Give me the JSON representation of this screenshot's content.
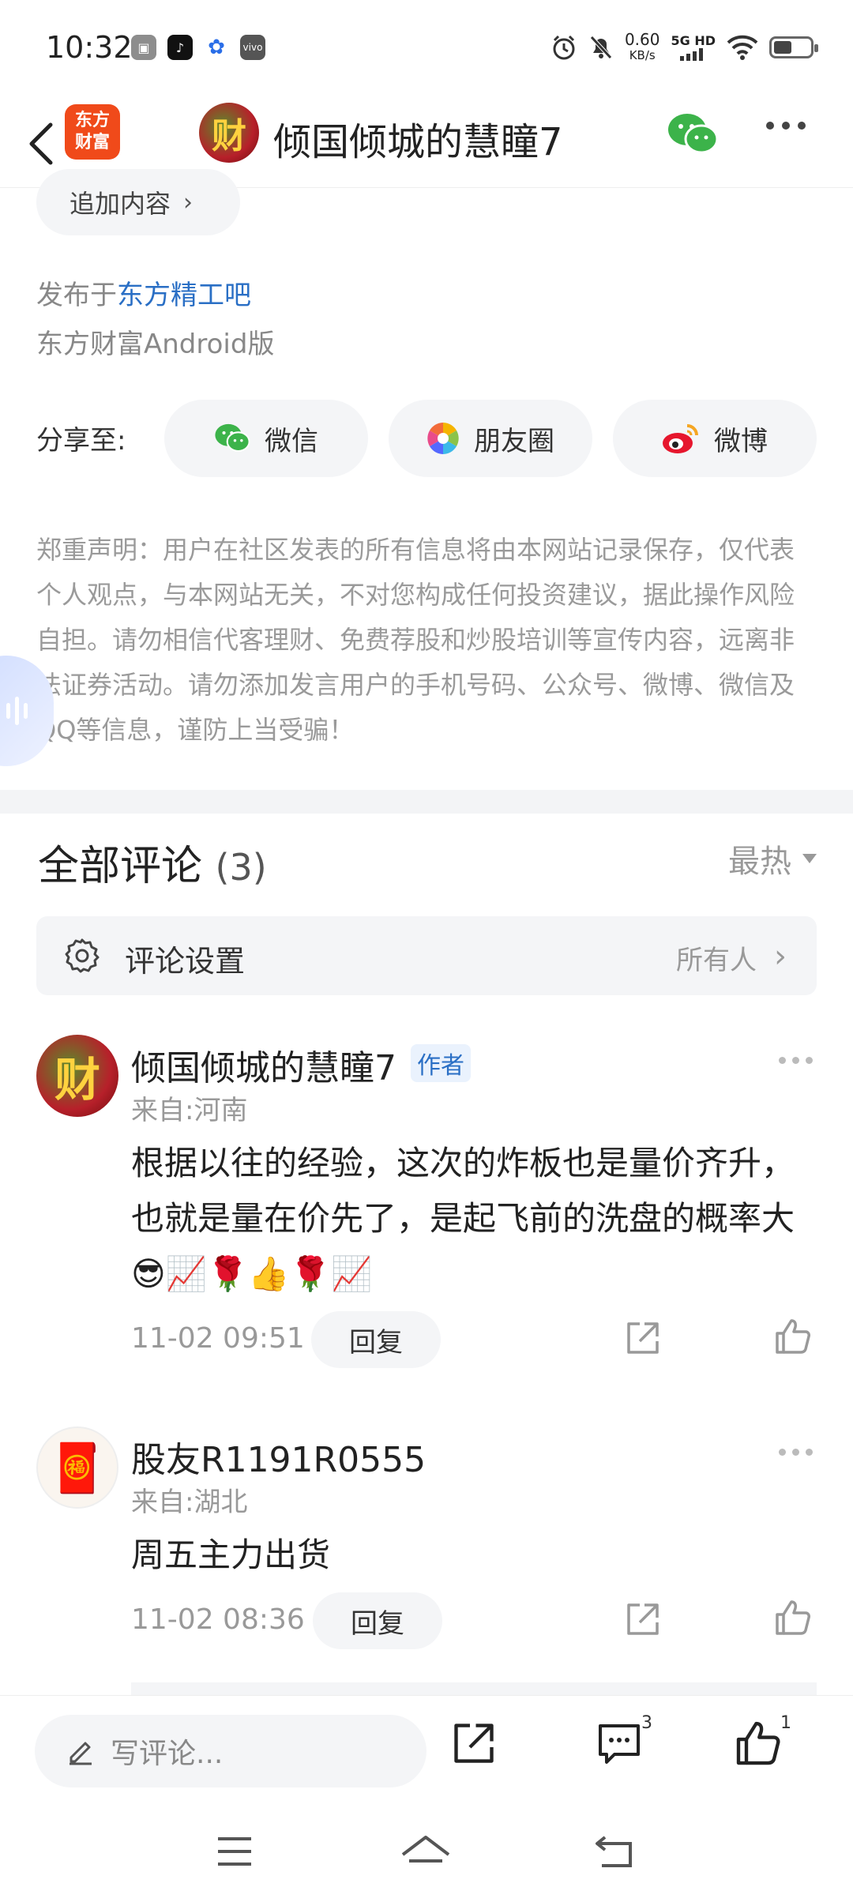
{
  "status_bar": {
    "time": "10:32",
    "speed_value": "0.60",
    "speed_unit": "KB/s",
    "network_top": "5G HD"
  },
  "header": {
    "logo_text_line1": "东方",
    "logo_text_line2": "财富",
    "avatar_char": "财",
    "title": "倾国倾城的慧瞳7"
  },
  "post": {
    "add_content_label": "追加内容",
    "published_prefix": "发布于",
    "forum_name": "东方精工吧",
    "client_info": "东方财富Android版"
  },
  "share": {
    "label": "分享至:",
    "buttons": [
      {
        "label": "微信",
        "icon": "wechat-icon"
      },
      {
        "label": "朋友圈",
        "icon": "moments-icon"
      },
      {
        "label": "微博",
        "icon": "weibo-icon"
      }
    ]
  },
  "disclaimer": "郑重声明：用户在社区发表的所有信息将由本网站记录保存，仅代表个人观点，与本网站无关，不对您构成任何投资建议，据此操作风险自担。请勿相信代客理财、免费荐股和炒股培训等宣传内容，远离非法证券活动。请勿添加发言用户的手机号码、公众号、微博、微信及QQ等信息，谨防上当受骗！",
  "comments_section": {
    "title": "全部评论",
    "count": "(3)",
    "sort_label": "最热",
    "settings_label": "评论设置",
    "settings_value": "所有人"
  },
  "comments": [
    {
      "name": "倾国倾城的慧瞳7",
      "badge": "作者",
      "avatar_char": "财",
      "location": "来自:河南",
      "text": "根据以往的经验，这次的炸板也是量价齐升，也就是量在价先了，是起飞前的洗盘的概率大😎📈🌹👍🌹📈",
      "time": "11-02 09:51",
      "reply_label": "回复"
    },
    {
      "name": "股友R1191R0555",
      "avatar_char": "🧧",
      "location": "来自:湖北",
      "text": "周五主力出货",
      "time": "11-02 08:36",
      "reply_label": "回复"
    }
  ],
  "bottom_bar": {
    "write_placeholder": "写评论...",
    "comment_count": "3",
    "like_count": "1"
  }
}
